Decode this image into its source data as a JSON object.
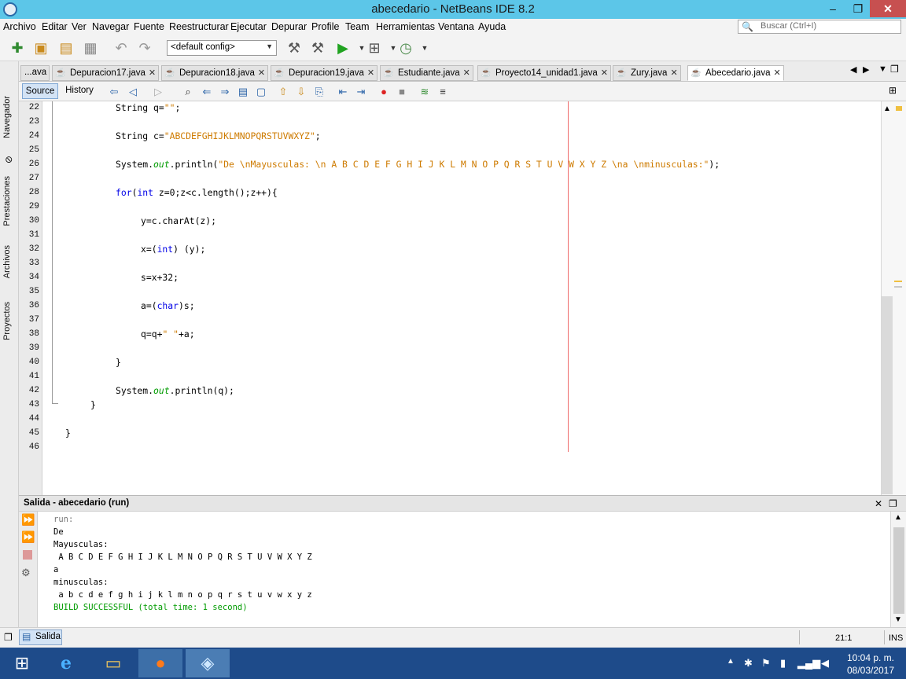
{
  "window": {
    "title": "abecedario - NetBeans IDE 8.2",
    "min": "–",
    "max": "❐",
    "close": "✕"
  },
  "menu": [
    "Archivo",
    "Editar",
    "Ver",
    "Navegar",
    "Fuente",
    "Reestructurar",
    "Ejecutar",
    "Depurar",
    "Profile",
    "Team",
    "Herramientas",
    "Ventana",
    "Ayuda"
  ],
  "search": {
    "placeholder": "Buscar (Ctrl+I)"
  },
  "toolbar": {
    "config": "<default config>"
  },
  "side_tabs": [
    "Navegador",
    "Prestaciones",
    "Archivos",
    "Proyectos"
  ],
  "tabs": [
    {
      "label": "...ava"
    },
    {
      "label": "Depuracion17.java"
    },
    {
      "label": "Depuracion18.java"
    },
    {
      "label": "Depuracion19.java"
    },
    {
      "label": "Estudiante.java"
    },
    {
      "label": "Proyecto14_unidad1.java"
    },
    {
      "label": "Zury.java"
    },
    {
      "label": "Abecedario.java"
    }
  ],
  "editor_toolbar": {
    "source": "Source",
    "history": "History"
  },
  "code_lines": [
    {
      "n": "22",
      "text": "String q=\"\";"
    },
    {
      "n": "23",
      "text": ""
    },
    {
      "n": "24",
      "text": "String c=\"ABCDEFGHIJKLMNOPQRSTUVWXYZ\";"
    },
    {
      "n": "25",
      "text": ""
    },
    {
      "n": "26",
      "text": "System.out.println(\"De \\nMayusculas: \\n A B C D E F G H I J K L M N O P Q R S T U V W X Y Z \\na \\nminusculas:\");"
    },
    {
      "n": "27",
      "text": ""
    },
    {
      "n": "28",
      "text": "for(int z=0;z<c.length();z++){"
    },
    {
      "n": "29",
      "text": ""
    },
    {
      "n": "30",
      "text": "y=c.charAt(z);"
    },
    {
      "n": "31",
      "text": ""
    },
    {
      "n": "32",
      "text": "x=(int) (y);"
    },
    {
      "n": "33",
      "text": ""
    },
    {
      "n": "34",
      "text": "s=x+32;"
    },
    {
      "n": "35",
      "text": ""
    },
    {
      "n": "36",
      "text": "a=(char)s;"
    },
    {
      "n": "37",
      "text": ""
    },
    {
      "n": "38",
      "text": "q=q+\" \"+a;"
    },
    {
      "n": "39",
      "text": ""
    },
    {
      "n": "40",
      "text": "}"
    },
    {
      "n": "41",
      "text": ""
    },
    {
      "n": "42",
      "text": "System.out.println(q);"
    },
    {
      "n": "43",
      "text": "}"
    },
    {
      "n": "44",
      "text": ""
    },
    {
      "n": "45",
      "text": "}"
    },
    {
      "n": "46",
      "text": ""
    }
  ],
  "output": {
    "title": "Salida - abecedario (run)",
    "lines": [
      "run:",
      "De",
      "Mayusculas:",
      " A B C D E F G H I J K L M N O P Q R S T U V W X Y Z",
      "a",
      "minusculas:",
      " a b c d e f g h i j k l m n o p q r s t u v w x y z",
      "BUILD SUCCESSFUL (total time: 1 second)"
    ]
  },
  "status": {
    "salida_tab": "Salida",
    "caret": "21:1",
    "mode": "INS"
  },
  "taskbar": {
    "time": "10:04 p. m.",
    "date": "08/03/2017"
  },
  "colors": {
    "titlebar": "#5cc6e8",
    "keyword": "#0000e6",
    "string": "#ce7b00",
    "field": "#009b00",
    "build_success": "#009b00",
    "taskbar": "#1e4b8a"
  }
}
